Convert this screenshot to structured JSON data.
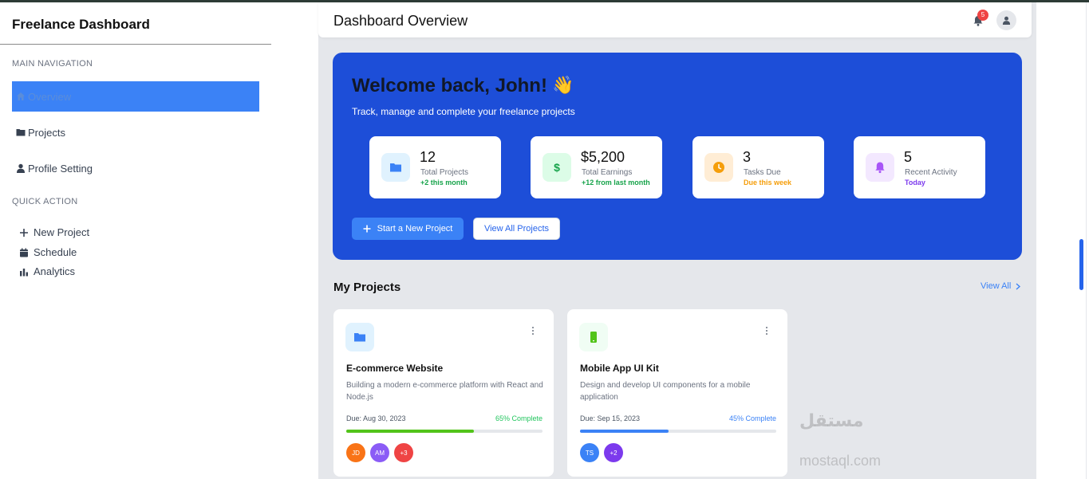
{
  "sidebar": {
    "brand": "Freelance Dashboard",
    "main_nav_label": "MAIN NAVIGATION",
    "nav": [
      {
        "label": "Overview",
        "icon": "home-icon",
        "active": true
      },
      {
        "label": "Projects",
        "icon": "folder-icon",
        "active": false
      },
      {
        "label": "Profile Setting",
        "icon": "user-icon",
        "active": false
      }
    ],
    "quick_label": "QUICK ACTION",
    "quick": [
      {
        "label": "New Project",
        "icon": "plus-icon"
      },
      {
        "label": "Schedule",
        "icon": "calendar-icon"
      },
      {
        "label": "Analytics",
        "icon": "bar-chart-icon"
      }
    ]
  },
  "topbar": {
    "title": "Dashboard Overview",
    "notification_count": "5"
  },
  "hero": {
    "title": "Welcome back, John!",
    "emoji": "👋",
    "subtitle": "Track, manage and complete your freelance projects",
    "stats": [
      {
        "value": "12",
        "label": "Total Projects",
        "sub": "+2 this month",
        "icon": "folder-icon",
        "color": "#3b82f6",
        "bg": "#e0f2fe",
        "sub_color": "#16a34a"
      },
      {
        "value": "$5,200",
        "label": "Total Earnings",
        "sub": "+12 from last month",
        "icon": "dollar-icon",
        "color": "#16a34a",
        "bg": "#dcfce7",
        "sub_color": "#16a34a"
      },
      {
        "value": "3",
        "label": "Tasks Due",
        "sub": "Due this week",
        "icon": "clock-icon",
        "color": "#f59e0b",
        "bg": "#ffedd5",
        "sub_color": "#f59e0b"
      },
      {
        "value": "5",
        "label": "Recent Activity",
        "sub": "Today",
        "icon": "bell-icon",
        "color": "#a855f7",
        "bg": "#f3e8ff",
        "sub_color": "#7c3aed"
      }
    ],
    "primary_button": "Start a New Project",
    "secondary_button": "View All Projects"
  },
  "projects": {
    "title": "My Projects",
    "view_all": "View All",
    "cards": [
      {
        "title": "E-commerce Website",
        "desc": "Building a modern e-commerce platform with React and Node.js",
        "due": "Due: Aug 30, 2023",
        "complete": "65% Complete",
        "progress": 0.65,
        "complete_color": "#22c55e",
        "progress_color": "#52c41a",
        "icon": "folder-icon",
        "icon_color": "#3b82f6",
        "icon_bg": "#e0f2fe",
        "avatars": [
          {
            "initials": "JD",
            "color": "#f97316"
          },
          {
            "initials": "AM",
            "color": "#8b5cf6"
          },
          {
            "initials": "+3",
            "color": "#ef4444"
          }
        ]
      },
      {
        "title": "Mobile App UI Kit",
        "desc": "Design and develop UI components for a mobile application",
        "due": "Due: Sep 15, 2023",
        "complete": "45% Complete",
        "progress": 0.45,
        "complete_color": "#3b82f6",
        "progress_color": "#3b82f6",
        "icon": "mobile-icon",
        "icon_color": "#52c41a",
        "icon_bg": "#f0fdf4",
        "avatars": [
          {
            "initials": "TS",
            "color": "#3b82f6"
          },
          {
            "initials": "+2",
            "color": "#7c3aed"
          }
        ]
      }
    ]
  },
  "watermark": {
    "arabic": "مستقل",
    "latin": "mostaql.com"
  }
}
